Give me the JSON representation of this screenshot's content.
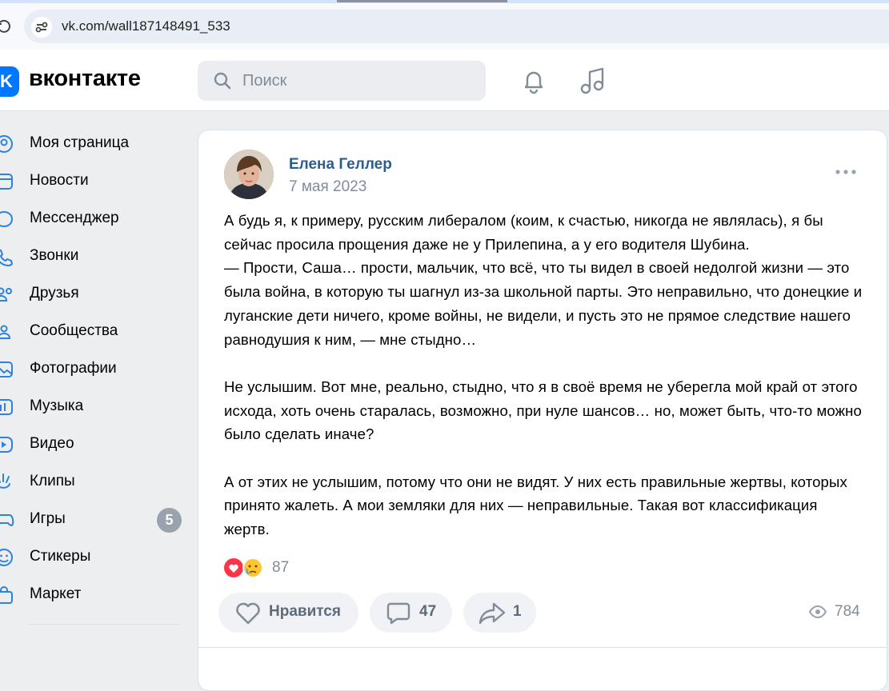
{
  "browser": {
    "url": "vk.com/wall187148491_533"
  },
  "header": {
    "logo_letter": "K",
    "wordmark": "вконтакте",
    "search_placeholder": "Поиск",
    "accent_color": "#0077ff"
  },
  "sidebar": {
    "items": [
      {
        "label": "Моя страница",
        "icon": "user-circle-icon"
      },
      {
        "label": "Новости",
        "icon": "news-icon"
      },
      {
        "label": "Мессенджер",
        "icon": "message-icon"
      },
      {
        "label": "Звонки",
        "icon": "phone-icon"
      },
      {
        "label": "Друзья",
        "icon": "friends-icon"
      },
      {
        "label": "Сообщества",
        "icon": "communities-icon"
      },
      {
        "label": "Фотографии",
        "icon": "photos-icon"
      },
      {
        "label": "Музыка",
        "icon": "music-icon"
      },
      {
        "label": "Видео",
        "icon": "video-icon"
      },
      {
        "label": "Клипы",
        "icon": "clips-icon"
      },
      {
        "label": "Игры",
        "icon": "games-icon",
        "badge": "5"
      },
      {
        "label": "Стикеры",
        "icon": "stickers-icon"
      },
      {
        "label": "Маркет",
        "icon": "market-icon"
      }
    ]
  },
  "post": {
    "author": "Елена Геллер",
    "date": "7 мая 2023",
    "paragraphs": [
      "А будь я, к примеру, русским либералом (коим, к счастью, никогда не являлась), я бы сейчас просила прощения даже не у Прилепина, а у его водителя Шубина.\n— Прости, Саша… прости, мальчик, что всё, что ты видел в своей недолгой жизни — это была война, в которую ты шагнул из-за школьной парты. Это неправильно, что донецкие и луганские дети ничего, кроме войны, не видели, и пусть это не прямое следствие нашего равнодушия к ним, — мне стыдно…",
      "Не услышим. Вот мне, реально, стыдно, что я в своё время не уберегла мой край от этого исхода, хоть очень старалась, возможно, при нуле шансов… но, может быть, что-то можно было сделать иначе?",
      "А от этих не услышим, потому что они не видят. У них есть правильные жертвы, которых принято жалеть. А мои земляки для них — неправильные. Такая вот классификация жертв."
    ],
    "reactions_count": "87",
    "actions": {
      "like_label": "Нравится",
      "comments_count": "47",
      "shares_count": "1"
    },
    "views_count": "784"
  }
}
